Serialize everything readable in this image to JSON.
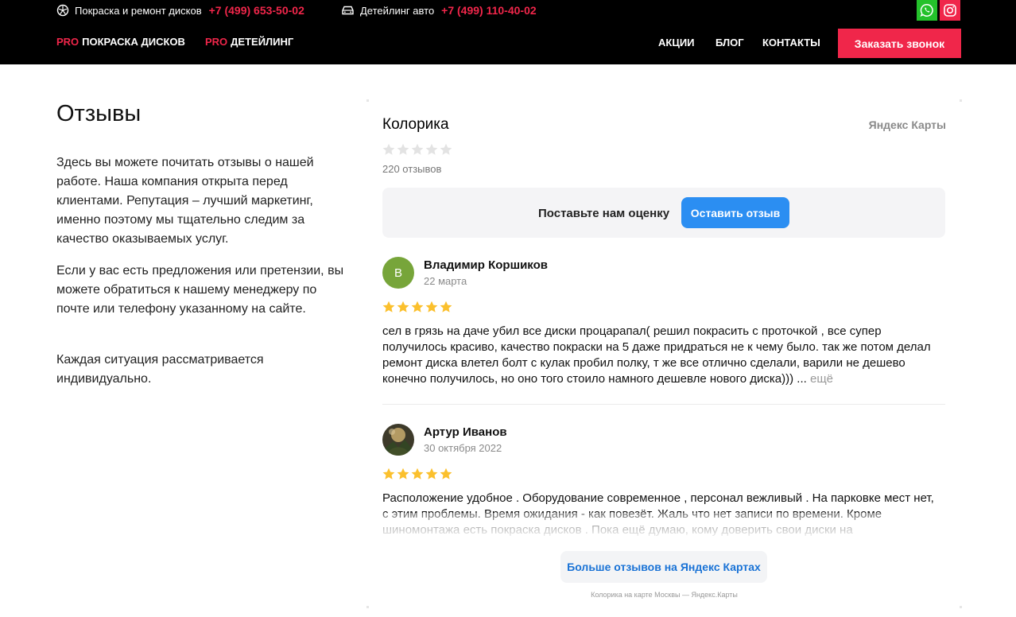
{
  "topbar": {
    "disks": {
      "label": "Покраска и ремонт дисков",
      "phone": "+7 (499) 653-50-02"
    },
    "detailing": {
      "label": "Детейлинг авто",
      "phone": "+7 (499) 110-40-02"
    }
  },
  "nav": {
    "left": [
      {
        "prefix": "PRO",
        "label": "ПОКРАСКА ДИСКОВ"
      },
      {
        "prefix": "PRO",
        "label": "ДЕТЕЙЛИНГ"
      }
    ],
    "right": [
      "АКЦИИ",
      "БЛОГ",
      "КОНТАКТЫ"
    ],
    "cta": "Заказать звонок"
  },
  "page": {
    "title": "Отзывы",
    "paragraphs": [
      "Здесь вы можете почитать отзывы о нашей работе. Наша компания открыта перед клиентами. Репутация – лучший маркетинг, именно поэтому мы тщательно следим за качество оказываемых услуг.",
      "Если у вас есть предложения или претензии, вы можете обратиться к нашему менеджеру по почте или телефону указанному на сайте.",
      "Каждая ситуация рассматривается индивидуально."
    ]
  },
  "widget": {
    "org_name": "Колорика",
    "source": "Яндекс Карты",
    "overall_rating": 0,
    "reviews_count": "220 отзывов",
    "rate_prompt": "Поставьте нам оценку",
    "rate_button": "Оставить отзыв",
    "reviews": [
      {
        "avatar_letter": "В",
        "avatar_color": "#77a53a",
        "name": "Владимир Коршиков",
        "date": "22 марта",
        "rating": 5,
        "text": "сел в грязь на даче убил все диски процарапал( решил покрасить с проточкой , все супер получилось красиво, качество покраски на 5 даже придраться не к чему было. так же потом делал ремонт диска влетел болт с кулак пробил полку, т же все отлично сделали, варили не дешево конечно получилось, но оно того стоило намного дешевле нового диска)))",
        "ellipsis": " ...",
        "more": " ещё"
      },
      {
        "avatar_letter": "",
        "avatar_color": "#5a4a2e",
        "name": "Артур Иванов",
        "date": "30 октября 2022",
        "rating": 5,
        "text": "Расположение удобное . Оборудование современное , персонал вежливый . На парковке мест нет, с этим проблемы. Время ожидания - как повезёт. Жаль что нет записи по времени. Кроме шиномонтажа есть покраска дисков . Пока ещё думаю, кому доверить свои диски на",
        "ellipsis": "",
        "more": ""
      }
    ],
    "more_button": "Больше отзывов на Яндекс Картах",
    "footer_note": "Колорика на карте Москвы — Яндекс.Карты"
  },
  "colors": {
    "accent": "#f0264a",
    "whatsapp": "#24c12b",
    "star_filled": "#fbc02d",
    "star_empty": "#e3e3e3",
    "button_blue": "#2b8ef2"
  },
  "icons": [
    "disk-icon",
    "car-icon",
    "whatsapp-icon",
    "instagram-icon",
    "star-icon"
  ]
}
